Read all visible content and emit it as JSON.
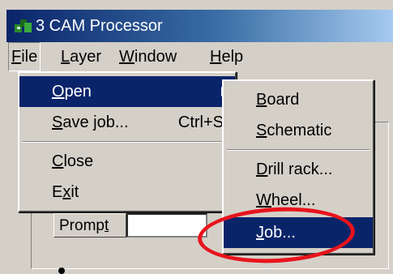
{
  "window": {
    "title": "3 CAM Processor"
  },
  "menubar": {
    "items": [
      {
        "pre": "",
        "acc": "F",
        "post": "ile"
      },
      {
        "pre": "",
        "acc": "L",
        "post": "ayer"
      },
      {
        "pre": "",
        "acc": "W",
        "post": "indow"
      },
      {
        "pre": "",
        "acc": "H",
        "post": "elp"
      }
    ]
  },
  "file_menu": {
    "items": [
      {
        "pre": "",
        "acc": "O",
        "post": "pen",
        "shortcut": ""
      },
      {
        "pre": "",
        "acc": "S",
        "post": "ave job...",
        "shortcut": "Ctrl+S"
      },
      {
        "pre": "",
        "acc": "C",
        "post": "lose",
        "shortcut": ""
      },
      {
        "pre": "E",
        "acc": "x",
        "post": "it",
        "shortcut": ""
      }
    ]
  },
  "open_submenu": {
    "items": [
      {
        "pre": "",
        "acc": "B",
        "post": "oard"
      },
      {
        "pre": "",
        "acc": "S",
        "post": "chematic"
      },
      {
        "pre": "",
        "acc": "D",
        "post": "rill rack..."
      },
      {
        "pre": "",
        "acc": "W",
        "post": "heel..."
      },
      {
        "pre": "",
        "acc": "J",
        "post": "ob..."
      }
    ]
  },
  "prompt": {
    "pre": "Promp",
    "acc": "t",
    "value": ""
  },
  "colors": {
    "highlight": "#0a246a",
    "annotation": "#e8141c"
  }
}
